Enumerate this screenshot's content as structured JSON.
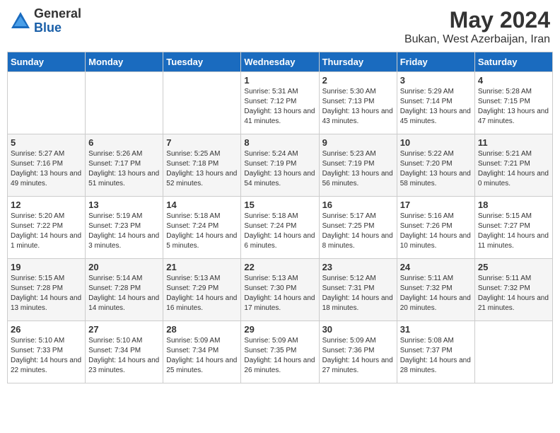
{
  "logo": {
    "general": "General",
    "blue": "Blue"
  },
  "title": {
    "month_year": "May 2024",
    "location": "Bukan, West Azerbaijan, Iran"
  },
  "weekdays": [
    "Sunday",
    "Monday",
    "Tuesday",
    "Wednesday",
    "Thursday",
    "Friday",
    "Saturday"
  ],
  "weeks": [
    [
      {
        "day": "",
        "info": ""
      },
      {
        "day": "",
        "info": ""
      },
      {
        "day": "",
        "info": ""
      },
      {
        "day": "1",
        "sunrise": "Sunrise: 5:31 AM",
        "sunset": "Sunset: 7:12 PM",
        "daylight": "Daylight: 13 hours and 41 minutes."
      },
      {
        "day": "2",
        "sunrise": "Sunrise: 5:30 AM",
        "sunset": "Sunset: 7:13 PM",
        "daylight": "Daylight: 13 hours and 43 minutes."
      },
      {
        "day": "3",
        "sunrise": "Sunrise: 5:29 AM",
        "sunset": "Sunset: 7:14 PM",
        "daylight": "Daylight: 13 hours and 45 minutes."
      },
      {
        "day": "4",
        "sunrise": "Sunrise: 5:28 AM",
        "sunset": "Sunset: 7:15 PM",
        "daylight": "Daylight: 13 hours and 47 minutes."
      }
    ],
    [
      {
        "day": "5",
        "sunrise": "Sunrise: 5:27 AM",
        "sunset": "Sunset: 7:16 PM",
        "daylight": "Daylight: 13 hours and 49 minutes."
      },
      {
        "day": "6",
        "sunrise": "Sunrise: 5:26 AM",
        "sunset": "Sunset: 7:17 PM",
        "daylight": "Daylight: 13 hours and 51 minutes."
      },
      {
        "day": "7",
        "sunrise": "Sunrise: 5:25 AM",
        "sunset": "Sunset: 7:18 PM",
        "daylight": "Daylight: 13 hours and 52 minutes."
      },
      {
        "day": "8",
        "sunrise": "Sunrise: 5:24 AM",
        "sunset": "Sunset: 7:19 PM",
        "daylight": "Daylight: 13 hours and 54 minutes."
      },
      {
        "day": "9",
        "sunrise": "Sunrise: 5:23 AM",
        "sunset": "Sunset: 7:19 PM",
        "daylight": "Daylight: 13 hours and 56 minutes."
      },
      {
        "day": "10",
        "sunrise": "Sunrise: 5:22 AM",
        "sunset": "Sunset: 7:20 PM",
        "daylight": "Daylight: 13 hours and 58 minutes."
      },
      {
        "day": "11",
        "sunrise": "Sunrise: 5:21 AM",
        "sunset": "Sunset: 7:21 PM",
        "daylight": "Daylight: 14 hours and 0 minutes."
      }
    ],
    [
      {
        "day": "12",
        "sunrise": "Sunrise: 5:20 AM",
        "sunset": "Sunset: 7:22 PM",
        "daylight": "Daylight: 14 hours and 1 minute."
      },
      {
        "day": "13",
        "sunrise": "Sunrise: 5:19 AM",
        "sunset": "Sunset: 7:23 PM",
        "daylight": "Daylight: 14 hours and 3 minutes."
      },
      {
        "day": "14",
        "sunrise": "Sunrise: 5:18 AM",
        "sunset": "Sunset: 7:24 PM",
        "daylight": "Daylight: 14 hours and 5 minutes."
      },
      {
        "day": "15",
        "sunrise": "Sunrise: 5:18 AM",
        "sunset": "Sunset: 7:24 PM",
        "daylight": "Daylight: 14 hours and 6 minutes."
      },
      {
        "day": "16",
        "sunrise": "Sunrise: 5:17 AM",
        "sunset": "Sunset: 7:25 PM",
        "daylight": "Daylight: 14 hours and 8 minutes."
      },
      {
        "day": "17",
        "sunrise": "Sunrise: 5:16 AM",
        "sunset": "Sunset: 7:26 PM",
        "daylight": "Daylight: 14 hours and 10 minutes."
      },
      {
        "day": "18",
        "sunrise": "Sunrise: 5:15 AM",
        "sunset": "Sunset: 7:27 PM",
        "daylight": "Daylight: 14 hours and 11 minutes."
      }
    ],
    [
      {
        "day": "19",
        "sunrise": "Sunrise: 5:15 AM",
        "sunset": "Sunset: 7:28 PM",
        "daylight": "Daylight: 14 hours and 13 minutes."
      },
      {
        "day": "20",
        "sunrise": "Sunrise: 5:14 AM",
        "sunset": "Sunset: 7:28 PM",
        "daylight": "Daylight: 14 hours and 14 minutes."
      },
      {
        "day": "21",
        "sunrise": "Sunrise: 5:13 AM",
        "sunset": "Sunset: 7:29 PM",
        "daylight": "Daylight: 14 hours and 16 minutes."
      },
      {
        "day": "22",
        "sunrise": "Sunrise: 5:13 AM",
        "sunset": "Sunset: 7:30 PM",
        "daylight": "Daylight: 14 hours and 17 minutes."
      },
      {
        "day": "23",
        "sunrise": "Sunrise: 5:12 AM",
        "sunset": "Sunset: 7:31 PM",
        "daylight": "Daylight: 14 hours and 18 minutes."
      },
      {
        "day": "24",
        "sunrise": "Sunrise: 5:11 AM",
        "sunset": "Sunset: 7:32 PM",
        "daylight": "Daylight: 14 hours and 20 minutes."
      },
      {
        "day": "25",
        "sunrise": "Sunrise: 5:11 AM",
        "sunset": "Sunset: 7:32 PM",
        "daylight": "Daylight: 14 hours and 21 minutes."
      }
    ],
    [
      {
        "day": "26",
        "sunrise": "Sunrise: 5:10 AM",
        "sunset": "Sunset: 7:33 PM",
        "daylight": "Daylight: 14 hours and 22 minutes."
      },
      {
        "day": "27",
        "sunrise": "Sunrise: 5:10 AM",
        "sunset": "Sunset: 7:34 PM",
        "daylight": "Daylight: 14 hours and 23 minutes."
      },
      {
        "day": "28",
        "sunrise": "Sunrise: 5:09 AM",
        "sunset": "Sunset: 7:34 PM",
        "daylight": "Daylight: 14 hours and 25 minutes."
      },
      {
        "day": "29",
        "sunrise": "Sunrise: 5:09 AM",
        "sunset": "Sunset: 7:35 PM",
        "daylight": "Daylight: 14 hours and 26 minutes."
      },
      {
        "day": "30",
        "sunrise": "Sunrise: 5:09 AM",
        "sunset": "Sunset: 7:36 PM",
        "daylight": "Daylight: 14 hours and 27 minutes."
      },
      {
        "day": "31",
        "sunrise": "Sunrise: 5:08 AM",
        "sunset": "Sunset: 7:37 PM",
        "daylight": "Daylight: 14 hours and 28 minutes."
      },
      {
        "day": "",
        "info": ""
      }
    ]
  ]
}
